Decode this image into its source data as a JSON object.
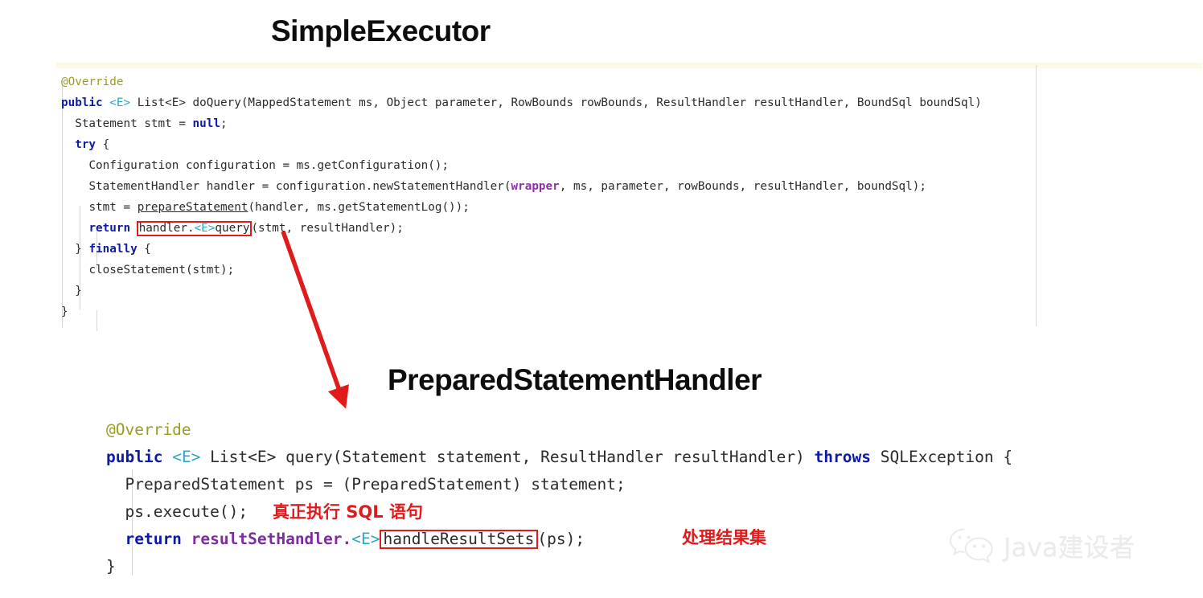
{
  "titles": {
    "simple_executor": "SimpleExecutor",
    "prepared_statement_handler": "PreparedStatementHandler"
  },
  "code_block_1": {
    "language": "java",
    "class_name": "SimpleExecutor",
    "tokens": {
      "annotation": "@Override",
      "kw_public": "public",
      "generic_e": "<E>",
      "signature_rest": " List<E> doQuery(MappedStatement ms, Object parameter, RowBounds rowBounds, ResultHandler resultHandler, BoundSql boundSql)",
      "line_stmt_null_a": "Statement stmt = ",
      "kw_null": "null",
      "line_stmt_null_b": ";",
      "kw_try": "try",
      "try_brace": " {",
      "line_config": "Configuration configuration = ms.getConfiguration();",
      "line_handler_a": "StatementHandler handler = configuration.newStatementHandler(",
      "tok_wrapper": "wrapper",
      "line_handler_b": ", ms, parameter, rowBounds, resultHandler, boundSql);",
      "line_prepare_a": "stmt = ",
      "line_prepare_ul": "prepareStatement",
      "line_prepare_b": "(handler, ms.getStatementLog());",
      "kw_return": "return",
      "boxed_handler_query_a": "handler.",
      "boxed_handler_query_gen": "<E>",
      "boxed_handler_query_b": "query",
      "line_return_rest": "(stmt, resultHandler);",
      "close_brace_finally_a": "} ",
      "kw_finally": "finally",
      "close_brace_finally_b": " {",
      "line_close_stmt": "closeStatement(stmt);",
      "brace_inner": "}",
      "brace_outer": "}"
    },
    "full_text": "@Override\npublic <E> List<E> doQuery(MappedStatement ms, Object parameter, RowBounds rowBounds, ResultHandler resultHandler, BoundSql boundSql)\n  Statement stmt = null;\n  try {\n    Configuration configuration = ms.getConfiguration();\n    StatementHandler handler = configuration.newStatementHandler(wrapper, ms, parameter, rowBounds, resultHandler, boundSql);\n    stmt = prepareStatement(handler, ms.getStatementLog());\n    return handler.<E>query(stmt, resultHandler);\n  } finally {\n    closeStatement(stmt);\n  }\n}"
  },
  "code_block_2": {
    "language": "java",
    "class_name": "PreparedStatementHandler",
    "tokens": {
      "annotation": "@Override",
      "kw_public": "public",
      "generic_e": "<E>",
      "signature_mid": " List<E> query(Statement statement, ResultHandler resultHandler) ",
      "kw_throws": "throws",
      "signature_end": " SQLException {",
      "line_ps": "PreparedStatement ps = (PreparedStatement) statement;",
      "line_execute": "ps.execute();",
      "kw_return": "return",
      "tok_result_set_handler": " resultSetHandler",
      "dot": ".",
      "generic_e2": "<E>",
      "boxed_handle_result_sets": "handleResultSets",
      "line_return_tail": "(ps);",
      "brace_close": "}"
    },
    "full_text": "@Override\npublic <E> List<E> query(Statement statement, ResultHandler resultHandler) throws SQLException {\n  PreparedStatement ps = (PreparedStatement) statement;\n  ps.execute();\n  return resultSetHandler.<E>handleResultSets(ps);\n}"
  },
  "annotations": {
    "sql_note": "真正执行 SQL 语句",
    "result_set_note": "处理结果集",
    "arrow_from": "handler.<E>query",
    "arrow_to": "PreparedStatementHandler"
  },
  "watermark": {
    "icon": "wechat-icon",
    "text": "Java建设者"
  },
  "colors": {
    "keyword": "#0d1aa8",
    "annotation_olive": "#9b9b22",
    "generic_cyan": "#2aa8c4",
    "magenta": "#8e2fa8",
    "purple": "#7b2d9e",
    "accent_red": "#e01b1b",
    "code_text": "#2b2b2b",
    "title": "#0d0d0d",
    "top_strip": "#fdf9e7",
    "watermark_gray": "#eaeaea"
  }
}
